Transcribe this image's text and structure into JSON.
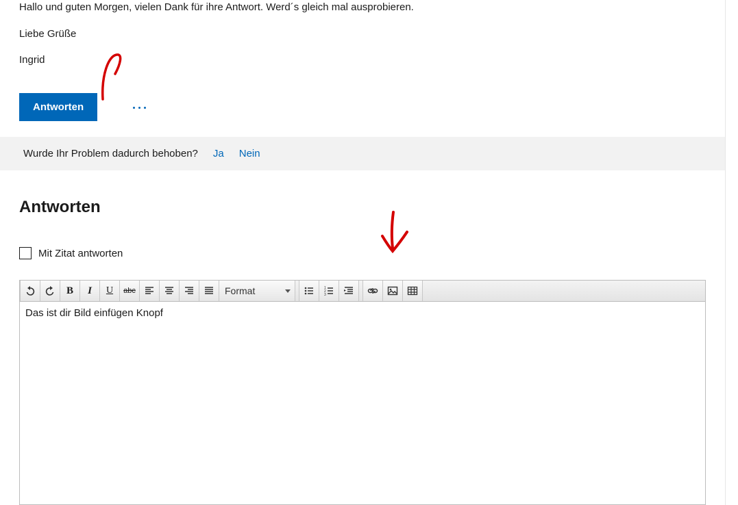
{
  "post": {
    "line1": "Hallo und guten Morgen, vielen Dank für ihre Antwort. Werd´s gleich mal ausprobieren.",
    "sig1": "Liebe Grüße",
    "sig2": "Ingrid"
  },
  "actions": {
    "reply_label": "Antworten",
    "more_label": "Mehr Aktionen"
  },
  "feedback": {
    "question": "Wurde Ihr Problem dadurch behoben?",
    "yes": "Ja",
    "no": "Nein"
  },
  "reply_section": {
    "heading": "Antworten",
    "quote_label": "Mit Zitat antworten"
  },
  "toolbar": {
    "format_label": "Format"
  },
  "editor": {
    "content": "Das ist dir Bild einfügen Knopf"
  }
}
